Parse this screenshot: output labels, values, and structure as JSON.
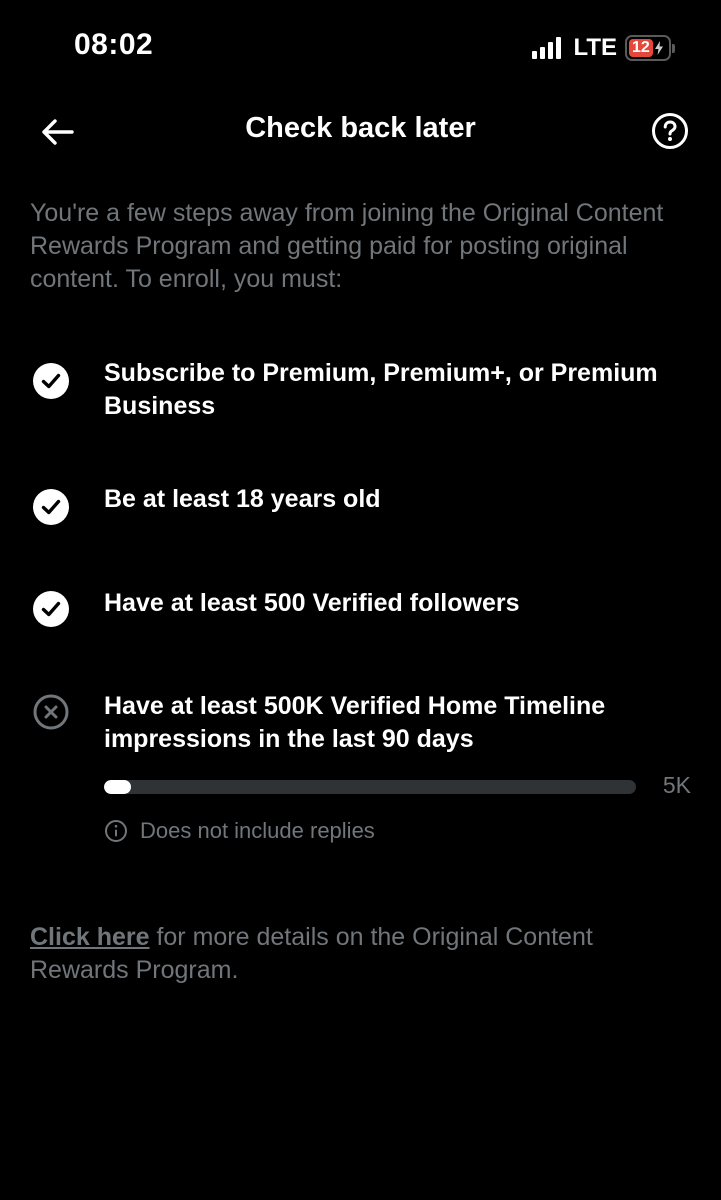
{
  "status_bar": {
    "time": "08:02",
    "network": "LTE",
    "battery": "12"
  },
  "header": {
    "title": "Check back later",
    "back_icon": "arrow-left-icon",
    "help_icon": "help-circle-icon"
  },
  "intro": {
    "text": "You're a few steps away from joining the Original Content Rewards Program and getting paid for posting original content. To enroll, you must:"
  },
  "requirements": [
    {
      "text": "Subscribe to Premium, Premium+, or Premium Business",
      "status": "met",
      "icon": "check-circle-icon"
    },
    {
      "text": "Be at least 18 years old",
      "status": "met",
      "icon": "check-circle-icon"
    },
    {
      "text": "Have at least 500 Verified followers",
      "status": "met",
      "icon": "check-circle-icon"
    },
    {
      "text": "Have at least 500K Verified Home Timeline impressions in the last 90 days",
      "status": "unmet",
      "icon": "x-circle-icon"
    }
  ],
  "progress": {
    "fraction": 0.05,
    "target_label": "5K",
    "note": "Does not include replies",
    "note_icon": "info-circle-icon"
  },
  "footer": {
    "link_label": "Click here",
    "rest_text": " for more details on the Original Content Rewards Program."
  },
  "colors": {
    "background": "#000000",
    "primary_text": "#ffffff",
    "secondary_text": "#71767b",
    "track": "#2f3336",
    "battery_low": "#e5483a"
  }
}
